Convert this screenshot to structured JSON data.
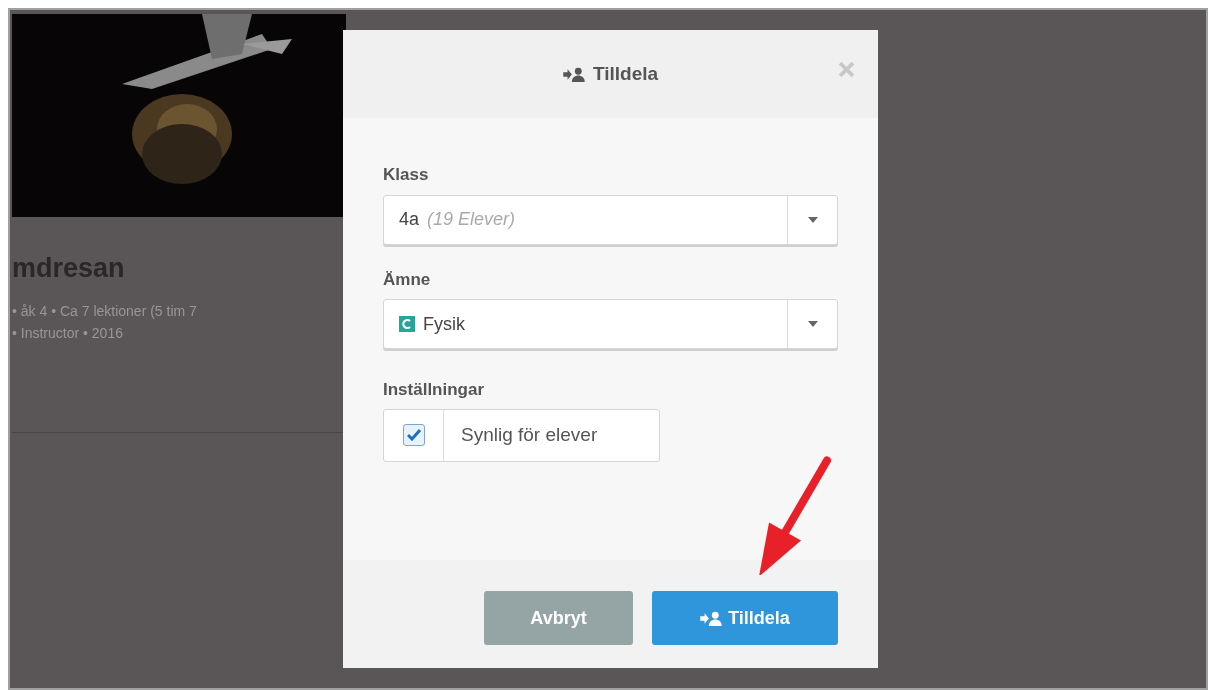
{
  "card": {
    "kind": "picture",
    "title": "mdresan",
    "meta": [
      "• åk 4 • Ca 7 lektioner (5 tim 7",
      "• Instructor • 2016"
    ]
  },
  "dialog": {
    "title": "Tilldela",
    "fields": [
      {
        "label": "Klass",
        "value": "4a",
        "hint": "(19 Elever)",
        "kind": "select"
      },
      {
        "label": "Ämne",
        "value": "Fysik",
        "kind": "subject-select"
      }
    ],
    "settings_label": "Inställningar",
    "setting": {
      "label": "Synlig för elever",
      "checked": true
    },
    "buttons": [
      {
        "label": "Avbryt",
        "kind": "cancel"
      },
      {
        "label": "Tilldela",
        "kind": "primary"
      }
    ]
  }
}
